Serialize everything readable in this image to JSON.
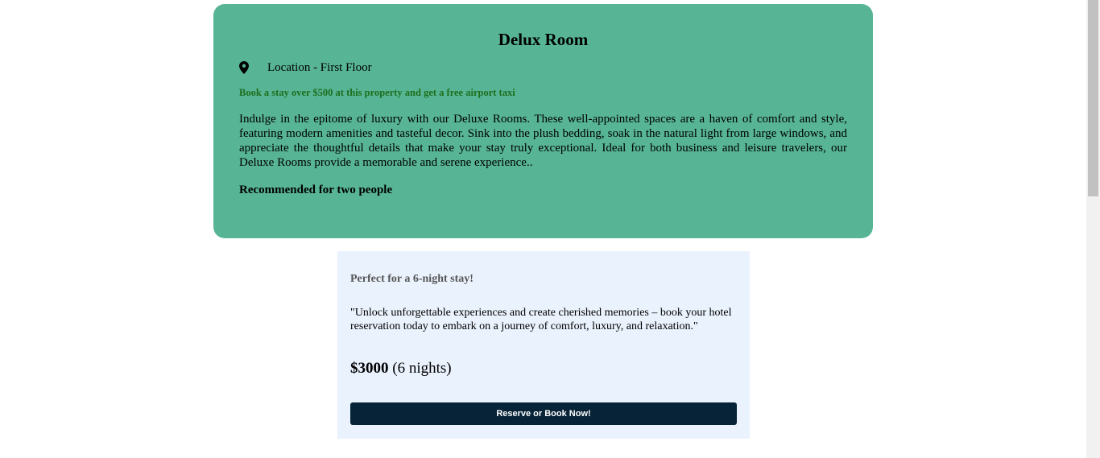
{
  "room": {
    "title": "Delux Room",
    "location_icon": "map-pin-icon",
    "location": "Location - First Floor",
    "promo": "Book a stay over $500 at this property and get a free airport taxi",
    "description": "Indulge in the epitome of luxury with our Deluxe Rooms. These well-appointed spaces are a haven of comfort and style, featuring modern amenities and tasteful decor. Sink into the plush bedding, soak in the natural light from large windows, and appreciate the thoughtful details that make your stay truly exceptional. Ideal for both business and leisure travelers, our Deluxe Rooms provide a memorable and serene experience..",
    "recommendation": "Recommended for two people"
  },
  "booking": {
    "stay_label": "Perfect for a 6-night stay!",
    "quote": "\"Unlock unforgettable experiences and create cherished memories – book your hotel reservation today to embark on a journey of comfort, luxury, and relaxation.\"",
    "price": "$3000",
    "nights": "(6 nights)",
    "button_label": "Reserve or Book Now!"
  },
  "colors": {
    "room_card_bg": "#57b595",
    "promo_text": "#1c6e1c",
    "booking_card_bg": "#eaf2fd",
    "button_bg": "#062338"
  }
}
